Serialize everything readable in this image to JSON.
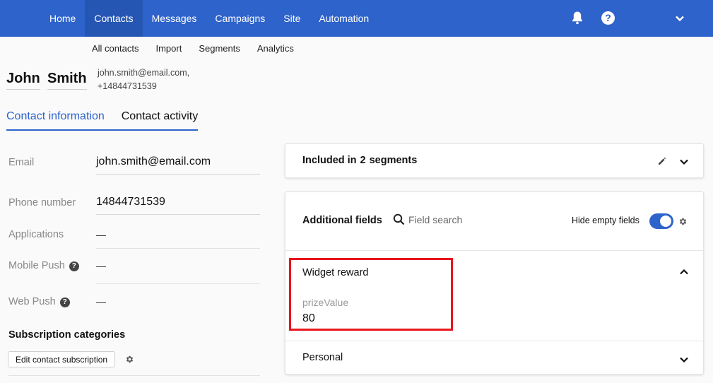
{
  "nav": {
    "items": [
      "Home",
      "Contacts",
      "Messages",
      "Campaigns",
      "Site",
      "Automation"
    ],
    "active": "Contacts"
  },
  "subnav": {
    "items": [
      "All contacts",
      "Import",
      "Segments",
      "Analytics"
    ]
  },
  "contact": {
    "first_name": "John",
    "last_name": "Smith",
    "email_line": "john.smith@email.com,",
    "phone_line": "+14844731539"
  },
  "tabs": {
    "info": "Contact information",
    "activity": "Contact activity"
  },
  "fields": {
    "email_label": "Email",
    "email_value": "john.smith@email.com",
    "phone_label": "Phone number",
    "phone_value": "14844731539",
    "applications_label": "Applications",
    "applications_value": "—",
    "mobile_push_label": "Mobile Push",
    "mobile_push_value": "—",
    "web_push_label": "Web Push",
    "web_push_value": "—",
    "help_glyph": "?"
  },
  "subscription": {
    "title": "Subscription categories",
    "edit_button": "Edit contact subscription"
  },
  "segments": {
    "prefix": "Included in",
    "count": "2",
    "suffix": "segments"
  },
  "additional": {
    "title": "Additional fields",
    "search_placeholder": "Field search",
    "hide_empty_label": "Hide empty fields",
    "hide_empty_on": true,
    "widget_group": "Widget reward",
    "prize_label": "prizeValue",
    "prize_value": "80",
    "personal_group": "Personal"
  },
  "colors": {
    "primary": "#2e63cc",
    "highlight": "#e8151b"
  },
  "icons": [
    "bell-icon",
    "help-icon",
    "chevron-down-icon",
    "pencil-icon",
    "search-icon",
    "gear-icon",
    "chevron-up-icon"
  ]
}
